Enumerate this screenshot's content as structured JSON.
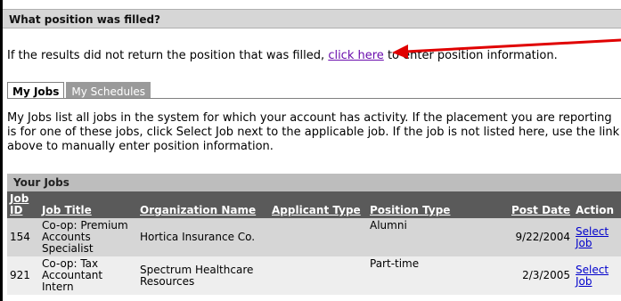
{
  "header": {
    "title": "What position was filled?"
  },
  "intro": {
    "before": "If the results did not return the position that was filled,",
    "link": "click here",
    "after": "to enter position information."
  },
  "tabs": [
    {
      "label": "My Jobs",
      "active": true
    },
    {
      "label": "My Schedules",
      "active": false
    }
  ],
  "description": "My Jobs list all jobs in the system for which your account has activity.  If the placement you are reporting is for one of these jobs, click Select Job next to the applicable job.  If the job is not listed here, use the link above to manually enter position information.",
  "jobs_section": {
    "title": "Your Jobs",
    "columns": {
      "id": "Job ID",
      "title": "Job Title",
      "org": "Organization Name",
      "applicant": "Applicant Type",
      "position": "Position Type",
      "date": "Post Date",
      "action": "Action"
    },
    "rows": [
      {
        "id": "154",
        "title": "Co-op: Premium Accounts Specialist",
        "org": "Hortica Insurance Co.",
        "applicant": "",
        "position": "Alumni",
        "date": "9/22/2004",
        "action": "Select Job"
      },
      {
        "id": "921",
        "title": "Co-op: Tax Accountant Intern",
        "org": "Spectrum Healthcare Resources",
        "applicant": "",
        "position": "Part-time",
        "date": "2/3/2005",
        "action": "Select Job"
      }
    ]
  },
  "colors": {
    "arrow": "#e00000",
    "header_bg": "#d6d6d6",
    "table_header_bg": "#5a5a5a",
    "link_visited": "#6a0dad",
    "link": "#0000cc"
  }
}
